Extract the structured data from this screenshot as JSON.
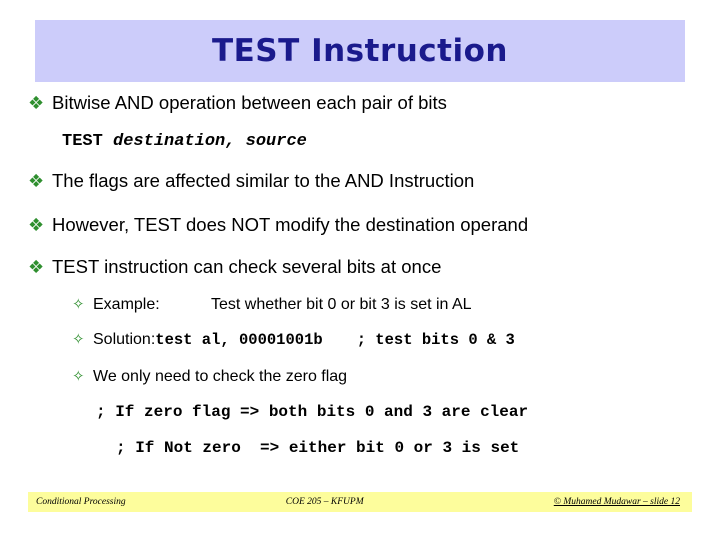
{
  "slide": {
    "title": "TEST Instruction",
    "banner_color": "#ccccfa",
    "title_color": "#1a1a8c",
    "bullet_glyph": "❖",
    "sub_bullet_glyph": "✧",
    "bullet_color": "#2f8f2f"
  },
  "bullets": [
    {
      "text": "Bitwise AND operation between each pair of bits"
    },
    {
      "text": "The flags are affected similar to the AND Instruction"
    },
    {
      "text": "However, TEST does NOT modify the destination operand"
    },
    {
      "text": "TEST instruction can check several bits at once"
    }
  ],
  "syntax": {
    "mnemonic": "TEST",
    "operands": "destination, source"
  },
  "sub_bullets": {
    "example_label": "Example:",
    "example_text": "Test whether bit 0 or bit 3 is set in AL",
    "solution_label": "Solution:",
    "solution_code": "test al, 00001001b",
    "solution_comment": "; test bits 0 & 3",
    "zero_flag_text": "We only need to check the zero flag"
  },
  "code_lines": [
    "; If zero flag => both bits 0 and 3 are clear",
    "; If Not zero  => either bit 0 or 3 is set"
  ],
  "footer": {
    "left": "Conditional Processing",
    "center": "COE 205 – KFUPM",
    "right": "© Muhamed Mudawar – slide 12",
    "band_color": "#fdfd9c"
  }
}
